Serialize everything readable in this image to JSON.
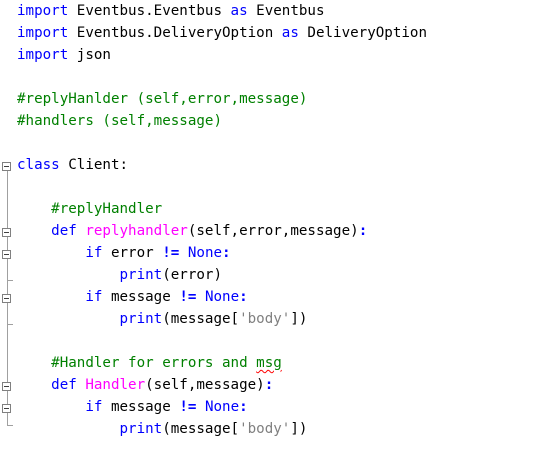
{
  "code": {
    "lines": [
      [
        {
          "t": "import",
          "c": "kw"
        },
        {
          "t": " Eventbus.Eventbus "
        },
        {
          "t": "as",
          "c": "kw"
        },
        {
          "t": " Eventbus"
        }
      ],
      [
        {
          "t": "import",
          "c": "kw"
        },
        {
          "t": " Eventbus.DeliveryOption "
        },
        {
          "t": "as",
          "c": "kw"
        },
        {
          "t": " DeliveryOption"
        }
      ],
      [
        {
          "t": "import",
          "c": "kw"
        },
        {
          "t": " json"
        }
      ],
      [],
      [
        {
          "t": "#replyHanlder (self,error,message)",
          "c": "cm"
        }
      ],
      [
        {
          "t": "#handlers (self,message)",
          "c": "cm"
        }
      ],
      [],
      [
        {
          "t": "class",
          "c": "kw"
        },
        {
          "t": " Client:"
        }
      ],
      [],
      [
        {
          "t": "    "
        },
        {
          "t": "#replyHandler",
          "c": "cm"
        }
      ],
      [
        {
          "t": "    "
        },
        {
          "t": "def",
          "c": "kw"
        },
        {
          "t": " "
        },
        {
          "t": "replyhandler",
          "c": "fn"
        },
        {
          "t": "(self,error,message)"
        },
        {
          "t": ":",
          "c": "op"
        }
      ],
      [
        {
          "t": "        "
        },
        {
          "t": "if",
          "c": "kw"
        },
        {
          "t": " error "
        },
        {
          "t": "!=",
          "c": "op"
        },
        {
          "t": " "
        },
        {
          "t": "None",
          "c": "kw"
        },
        {
          "t": ":",
          "c": "op"
        }
      ],
      [
        {
          "t": "            "
        },
        {
          "t": "print",
          "c": "kw"
        },
        {
          "t": "(error)"
        }
      ],
      [
        {
          "t": "        "
        },
        {
          "t": "if",
          "c": "kw"
        },
        {
          "t": " message "
        },
        {
          "t": "!=",
          "c": "op"
        },
        {
          "t": " "
        },
        {
          "t": "None",
          "c": "kw"
        },
        {
          "t": ":",
          "c": "op"
        }
      ],
      [
        {
          "t": "            "
        },
        {
          "t": "print",
          "c": "kw"
        },
        {
          "t": "(message["
        },
        {
          "t": "'body'",
          "c": "st"
        },
        {
          "t": "])"
        }
      ],
      [],
      [
        {
          "t": "    "
        },
        {
          "t": "#Handler for errors and ",
          "c": "cm"
        },
        {
          "t": "msg",
          "c": "cm squiggle"
        }
      ],
      [
        {
          "t": "    "
        },
        {
          "t": "def",
          "c": "kw"
        },
        {
          "t": " "
        },
        {
          "t": "Handler",
          "c": "fn"
        },
        {
          "t": "(self,message)"
        },
        {
          "t": ":",
          "c": "op"
        }
      ],
      [
        {
          "t": "        "
        },
        {
          "t": "if",
          "c": "kw"
        },
        {
          "t": " message "
        },
        {
          "t": "!=",
          "c": "op"
        },
        {
          "t": " "
        },
        {
          "t": "None",
          "c": "kw"
        },
        {
          "t": ":",
          "c": "op"
        }
      ],
      [
        {
          "t": "            "
        },
        {
          "t": "print",
          "c": "kw"
        },
        {
          "t": "(message["
        },
        {
          "t": "'body'",
          "c": "st"
        },
        {
          "t": "])"
        }
      ]
    ]
  },
  "colors": {
    "keyword": "#0000ff",
    "comment": "#008000",
    "function_name": "#ff00ff",
    "string": "#808080",
    "operator": "#0000ff",
    "spelling_error": "#ff0000"
  }
}
